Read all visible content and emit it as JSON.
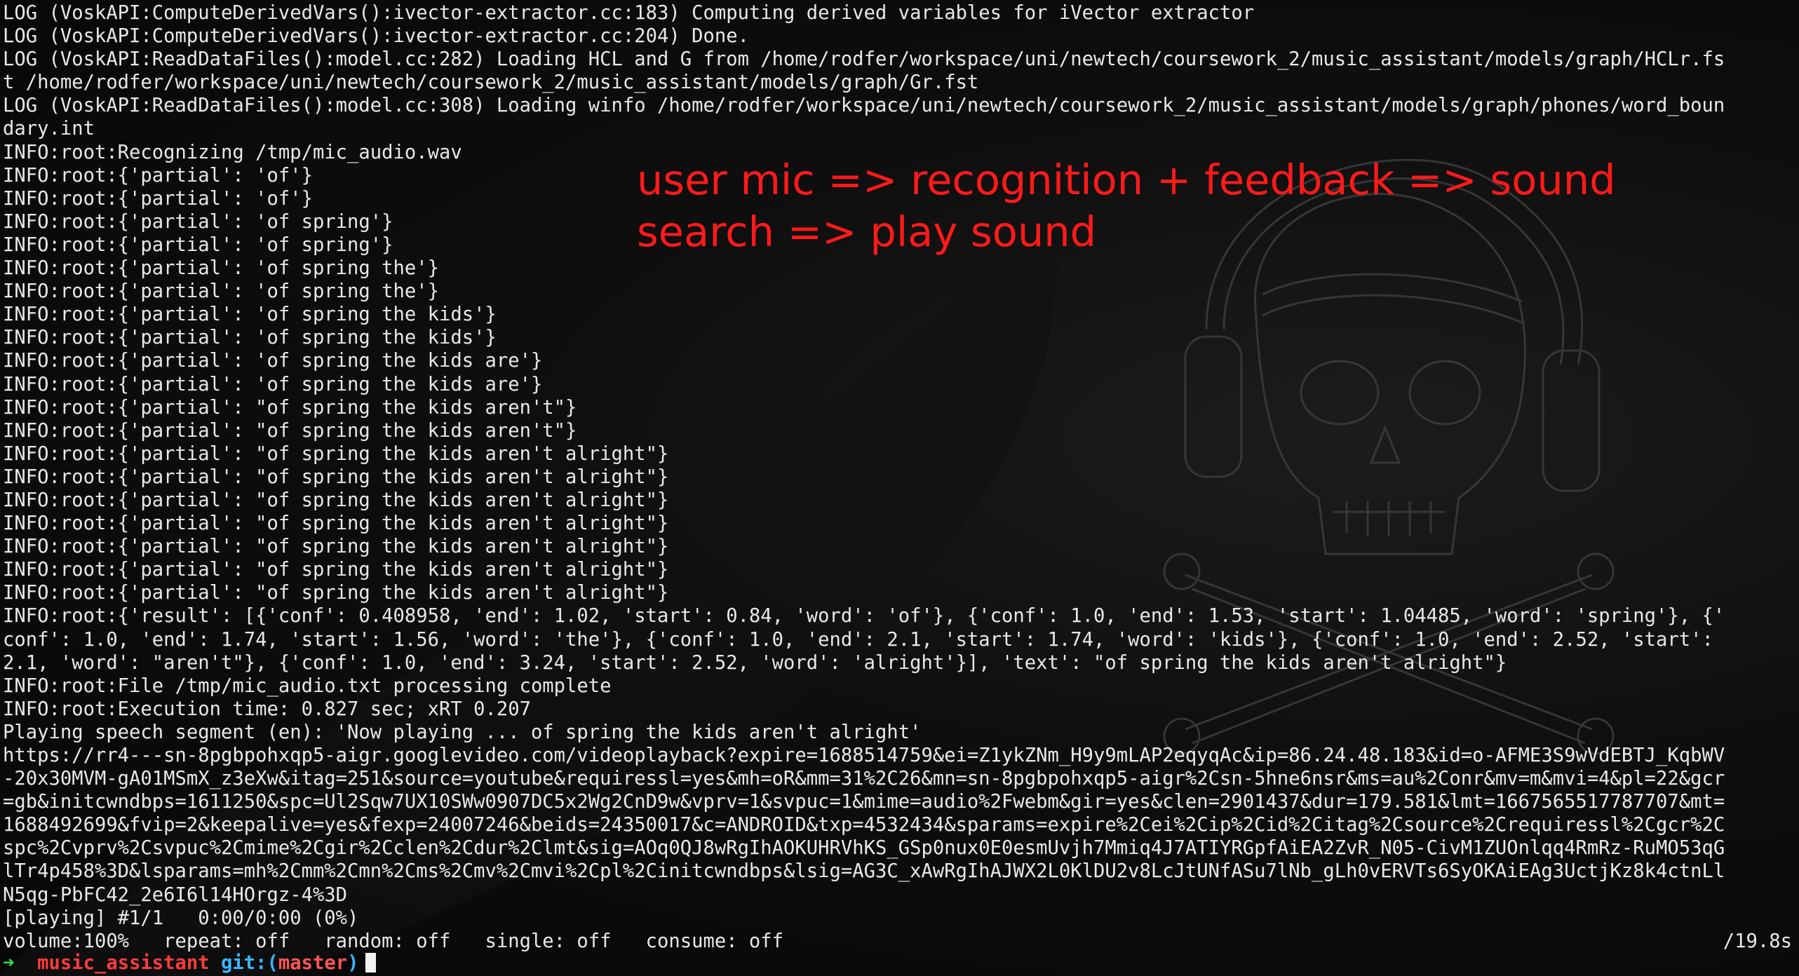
{
  "terminal": {
    "lines": [
      "LOG (VoskAPI:ComputeDerivedVars():ivector-extractor.cc:183) Computing derived variables for iVector extractor",
      "LOG (VoskAPI:ComputeDerivedVars():ivector-extractor.cc:204) Done.",
      "LOG (VoskAPI:ReadDataFiles():model.cc:282) Loading HCL and G from /home/rodfer/workspace/uni/newtech/coursework_2/music_assistant/models/graph/HCLr.fs",
      "t /home/rodfer/workspace/uni/newtech/coursework_2/music_assistant/models/graph/Gr.fst",
      "LOG (VoskAPI:ReadDataFiles():model.cc:308) Loading winfo /home/rodfer/workspace/uni/newtech/coursework_2/music_assistant/models/graph/phones/word_boun",
      "dary.int",
      "INFO:root:Recognizing /tmp/mic_audio.wav",
      "INFO:root:{'partial': 'of'}",
      "INFO:root:{'partial': 'of'}",
      "INFO:root:{'partial': 'of spring'}",
      "INFO:root:{'partial': 'of spring'}",
      "INFO:root:{'partial': 'of spring the'}",
      "INFO:root:{'partial': 'of spring the'}",
      "INFO:root:{'partial': 'of spring the kids'}",
      "INFO:root:{'partial': 'of spring the kids'}",
      "INFO:root:{'partial': 'of spring the kids are'}",
      "INFO:root:{'partial': 'of spring the kids are'}",
      "INFO:root:{'partial': \"of spring the kids aren't\"}",
      "INFO:root:{'partial': \"of spring the kids aren't\"}",
      "INFO:root:{'partial': \"of spring the kids aren't alright\"}",
      "INFO:root:{'partial': \"of spring the kids aren't alright\"}",
      "INFO:root:{'partial': \"of spring the kids aren't alright\"}",
      "INFO:root:{'partial': \"of spring the kids aren't alright\"}",
      "INFO:root:{'partial': \"of spring the kids aren't alright\"}",
      "INFO:root:{'partial': \"of spring the kids aren't alright\"}",
      "INFO:root:{'partial': \"of spring the kids aren't alright\"}",
      "INFO:root:{'result': [{'conf': 0.408958, 'end': 1.02, 'start': 0.84, 'word': 'of'}, {'conf': 1.0, 'end': 1.53, 'start': 1.04485, 'word': 'spring'}, {'",
      "conf': 1.0, 'end': 1.74, 'start': 1.56, 'word': 'the'}, {'conf': 1.0, 'end': 2.1, 'start': 1.74, 'word': 'kids'}, {'conf': 1.0, 'end': 2.52, 'start':",
      "2.1, 'word': \"aren't\"}, {'conf': 1.0, 'end': 3.24, 'start': 2.52, 'word': 'alright'}], 'text': \"of spring the kids aren't alright\"}",
      "INFO:root:File /tmp/mic_audio.txt processing complete",
      "INFO:root:Execution time: 0.827 sec; xRT 0.207",
      "Playing speech segment (en): 'Now playing ... of spring the kids aren't alright'",
      "https://rr4---sn-8pgbpohxqp5-aigr.googlevideo.com/videoplayback?expire=1688514759&ei=Z1ykZNm_H9y9mLAP2eqyqAc&ip=86.24.48.183&id=o-AFME3S9wVdEBTJ_KqbWV",
      "-20x30MVM-gA01MSmX_z3eXw&itag=251&source=youtube&requiressl=yes&mh=oR&mm=31%2C26&mn=sn-8pgbpohxqp5-aigr%2Csn-5hne6nsr&ms=au%2Conr&mv=m&mvi=4&pl=22&gcr",
      "=gb&initcwndbps=1611250&spc=Ul2Sqw7UX10SWw0907DC5x2Wg2CnD9w&vprv=1&svpuc=1&mime=audio%2Fwebm&gir=yes&clen=2901437&dur=179.581&lmt=1667565517787707&mt=",
      "1688492699&fvip=2&keepalive=yes&fexp=24007246&beids=24350017&c=ANDROID&txp=4532434&sparams=expire%2Cei%2Cip%2Cid%2Citag%2Csource%2Crequiressl%2Cgcr%2C",
      "spc%2Cvprv%2Csvpuc%2Cmime%2Cgir%2Cclen%2Cdur%2Clmt&sig=AOq0QJ8wRgIhAOKUHRVhKS_GSp0nux0E0esmUvjh7Mmiq4J7ATIYRGpfAiEA2ZvR_N05-CivM1ZUOnlqq4RmRz-RuMO53qG",
      "lTr4p458%3D&lsparams=mh%2Cmm%2Cmn%2Cms%2Cmv%2Cmvi%2Cpl%2Cinitcwndbps&lsig=AG3C_xAwRgIhAJWX2L0KlDU2v8LcJtUNfASu7lNb_gLh0vERVTs6SyOKAiEAg3UctjKz8k4ctnLl",
      "N5qg-PbFC42_2e6I6l14HOrgz-4%3D",
      "[playing] #1/1   0:00/0:00 (0%)",
      "volume:100%   repeat: off   random: off   single: off   consume: off"
    ],
    "status_right": "/19.8s"
  },
  "annotation": {
    "line1": "user mic => recognition + feedback => sound",
    "line2": "search => play sound",
    "color": "#ff1a1a"
  },
  "prompt": {
    "arrow": "➜",
    "directory": "music_assistant",
    "git_label": "git:",
    "paren_open": "(",
    "branch": "master",
    "paren_close": ")"
  },
  "wallpaper": {
    "icon": "skull-headphones-icon"
  }
}
